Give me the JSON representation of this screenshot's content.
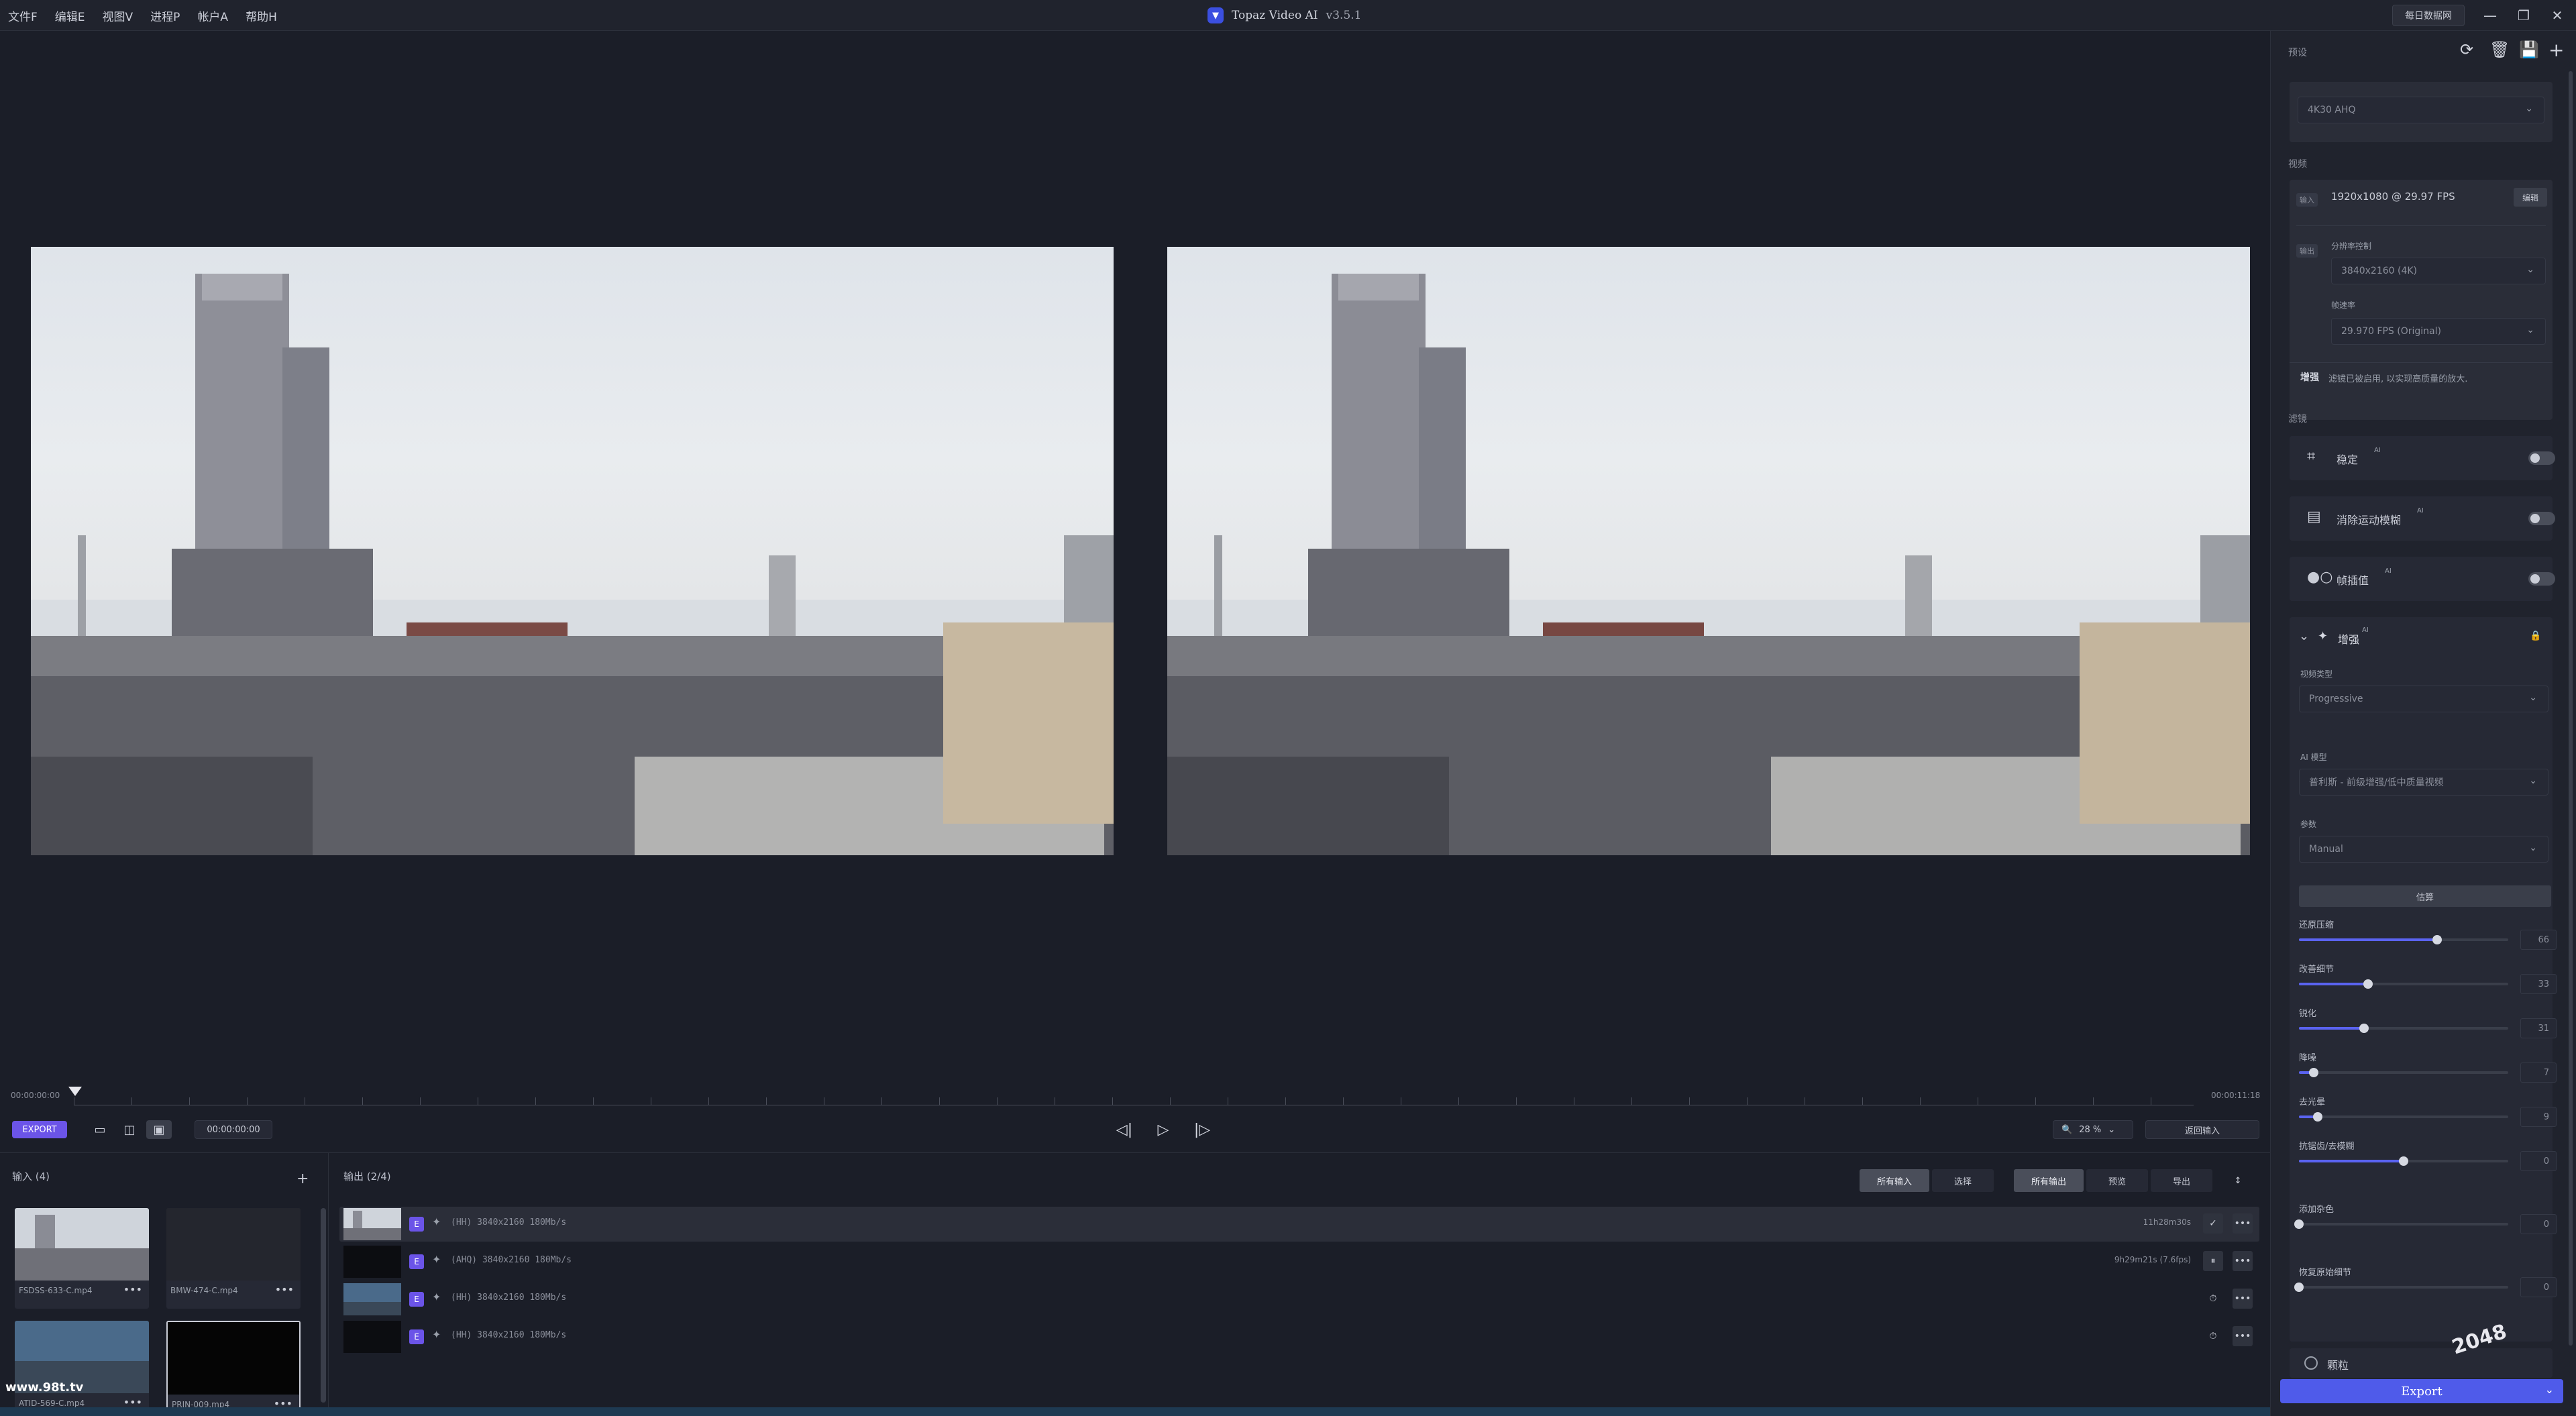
{
  "menu": [
    "文件F",
    "编辑E",
    "视图V",
    "进程P",
    "帐户A",
    "帮助H"
  ],
  "app": {
    "title": "Topaz Video AI",
    "version": "v3.5.1",
    "feedback": "每日数据网"
  },
  "window": {
    "minimize": "—",
    "restore": "❐",
    "close": "✕"
  },
  "timeline": {
    "start": "00:00:00:00",
    "end": "00:00:11:18",
    "current": "00:00:00:00",
    "zoom": "28 %",
    "back": "返回输入",
    "export_small": "EXPORT",
    "view_single": "▭",
    "view_split": "◫",
    "view_side": "▣",
    "prev": "◁|",
    "play": "▷",
    "next": "|▷",
    "zoom_icon": "🔍",
    "zoom_chev": "⌄",
    "dash": "-"
  },
  "inputs": {
    "header": "输入 (4)",
    "add": "+",
    "items": [
      {
        "name": "FSDSS-633-C.mp4",
        "more": "•••"
      },
      {
        "name": "BMW-474-C.mp4",
        "more": "•••"
      },
      {
        "name": "ATID-569-C.mp4",
        "more": "•••"
      },
      {
        "name": "PRIN-009.mp4",
        "more": "•••"
      }
    ]
  },
  "outputs": {
    "header": "输出 (2/4)",
    "filters": [
      "所有输入",
      "选择",
      "所有输出",
      "预览",
      "导出"
    ],
    "sort_icon": "↕",
    "rows": [
      {
        "badge": "E",
        "text": "(HH) 3840x2160 180Mb/s",
        "status": "11h28m30s",
        "action": "✓",
        "more": "•••"
      },
      {
        "badge": "E",
        "text": "(AHQ) 3840x2160 180Mb/s",
        "status": "9h29m21s (7.6fps)",
        "action": "⏸",
        "more": "•••"
      },
      {
        "badge": "E",
        "text": "(HH) 3840x2160 180Mb/s",
        "status": "",
        "action": "⏱",
        "more": "•••"
      },
      {
        "badge": "E",
        "text": "(HH) 3840x2160 180Mb/s",
        "status": "",
        "action": "⏱",
        "more": "•••"
      }
    ]
  },
  "right": {
    "preset_label": "预设",
    "preset_icons": {
      "reset": "⟳",
      "delete": "🗑",
      "save": "💾",
      "add": "+"
    },
    "preset_value": "4K30 AHQ",
    "video_label": "视频",
    "input_tag": "输入",
    "input_value": "1920x1080 @ 29.97 FPS",
    "edit_btn": "编辑",
    "output_tag": "输出",
    "res_label": "分辨率控制",
    "res_value": "3840x2160 (4K)",
    "fps_label": "帧速率",
    "fps_value": "29.970 FPS (Original)",
    "enhance_note_key": "增强",
    "enhance_note": "滤镜已被启用, 以实现高质量的放大.",
    "filters_label": "滤镜",
    "f_stabilize": "稳定",
    "f_motion": "消除运动模糊",
    "f_interp": "帧插值",
    "ai_sup": "AI",
    "enhance_title": "增强",
    "video_type_label": "视频类型",
    "video_type": "Progressive",
    "ai_model_label": "AI 模型",
    "ai_model": "普利斯 - 前级增强/低中质量视频",
    "param_label": "参数",
    "param_value": "Manual",
    "estimate_btn": "估算",
    "grain": "颗粒",
    "export_btn": "Export",
    "chev": "⌄",
    "lock": "🔒",
    "expand": "⌄",
    "sliders": [
      {
        "label": "还原压缩",
        "value": "66",
        "frac": 0.66
      },
      {
        "label": "改善细节",
        "value": "33",
        "frac": 0.33
      },
      {
        "label": "锐化",
        "value": "31",
        "frac": 0.31
      },
      {
        "label": "降噪",
        "value": "7",
        "frac": 0.07
      },
      {
        "label": "去光晕",
        "value": "9",
        "frac": 0.09
      },
      {
        "label": "抗锯齿/去模糊",
        "value": "0",
        "frac": 0.5
      },
      {
        "label": "添加杂色",
        "value": "0",
        "frac": 0.0
      },
      {
        "label": "恢复原始细节",
        "value": "0",
        "frac": 0.0
      }
    ]
  },
  "watermarks": {
    "left": "www.98t.tv",
    "right": "2048"
  }
}
